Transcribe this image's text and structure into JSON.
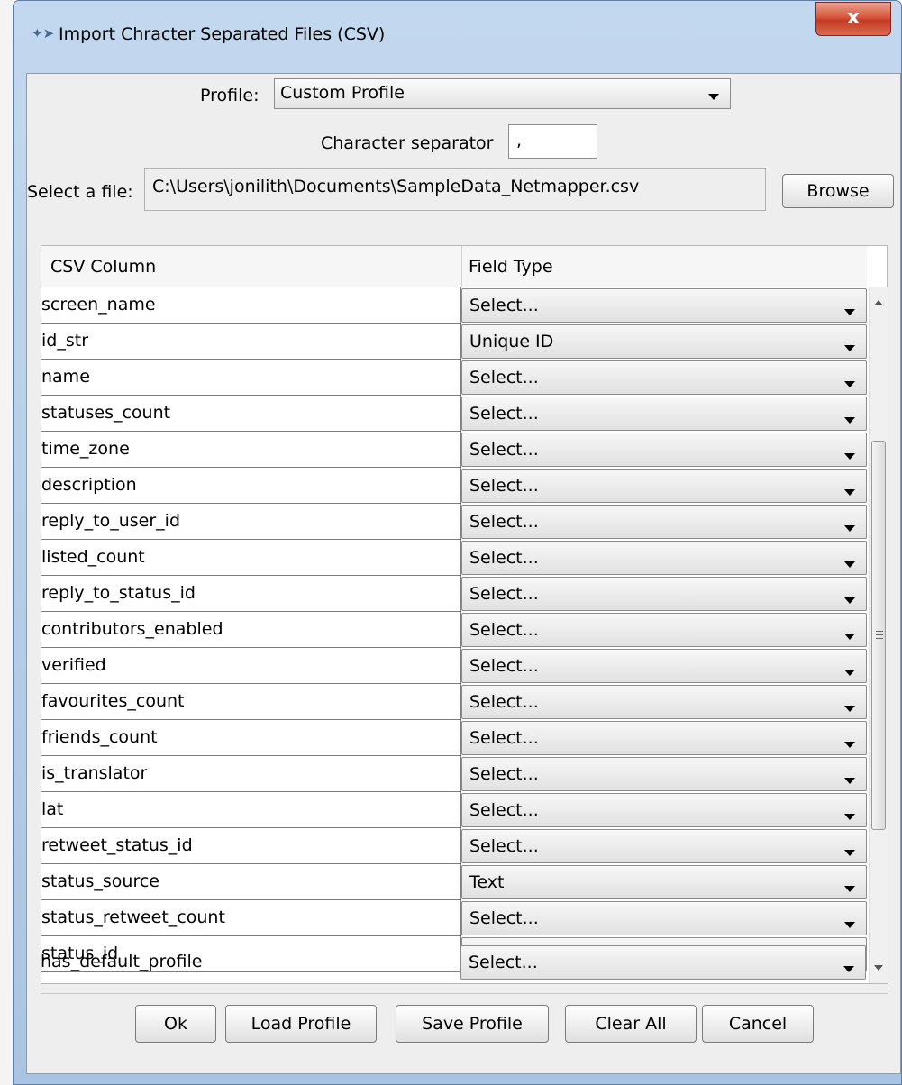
{
  "window": {
    "title": "Import Chracter Separated Files (CSV)",
    "close_label": "x"
  },
  "form": {
    "profile_label": "Profile:",
    "profile_value": "Custom Profile",
    "separator_label": "Character separator",
    "separator_value": ",",
    "file_label": "Select a file:",
    "file_path": "C:\\Users\\jonilith\\Documents\\SampleData_Netmapper.csv",
    "browse_label": "Browse"
  },
  "table": {
    "headers": [
      "CSV Column",
      "Field Type"
    ],
    "rows": [
      {
        "column": "screen_name",
        "type": "Select..."
      },
      {
        "column": "id_str",
        "type": "Unique ID"
      },
      {
        "column": "name",
        "type": "Select..."
      },
      {
        "column": "statuses_count",
        "type": "Select..."
      },
      {
        "column": "time_zone",
        "type": "Select..."
      },
      {
        "column": "description",
        "type": "Select..."
      },
      {
        "column": "reply_to_user_id",
        "type": "Select..."
      },
      {
        "column": "listed_count",
        "type": "Select..."
      },
      {
        "column": "reply_to_status_id",
        "type": "Select..."
      },
      {
        "column": "contributors_enabled",
        "type": "Select..."
      },
      {
        "column": "verified",
        "type": "Select..."
      },
      {
        "column": "favourites_count",
        "type": "Select..."
      },
      {
        "column": "friends_count",
        "type": "Select..."
      },
      {
        "column": "is_translator",
        "type": "Select..."
      },
      {
        "column": "lat",
        "type": "Select..."
      },
      {
        "column": "retweet_status_id",
        "type": "Select..."
      },
      {
        "column": "status_source",
        "type": "Text"
      },
      {
        "column": "status_retweet_count",
        "type": "Select..."
      },
      {
        "column": "status_id",
        "type": "Select..."
      },
      {
        "column": "has_default_profile",
        "type": "Select..."
      }
    ]
  },
  "buttons": {
    "ok": "Ok",
    "load_profile": "Load Profile",
    "save_profile": "Save Profile",
    "clear_all": "Clear All",
    "cancel": "Cancel"
  },
  "icons": {
    "app": "csv-import-icon",
    "close": "close-icon",
    "dropdown": "chevron-down-icon"
  },
  "colors": {
    "titlebar": "#b4cce8",
    "close_button": "#d24a30",
    "dialog_background": "#eeeeee"
  }
}
